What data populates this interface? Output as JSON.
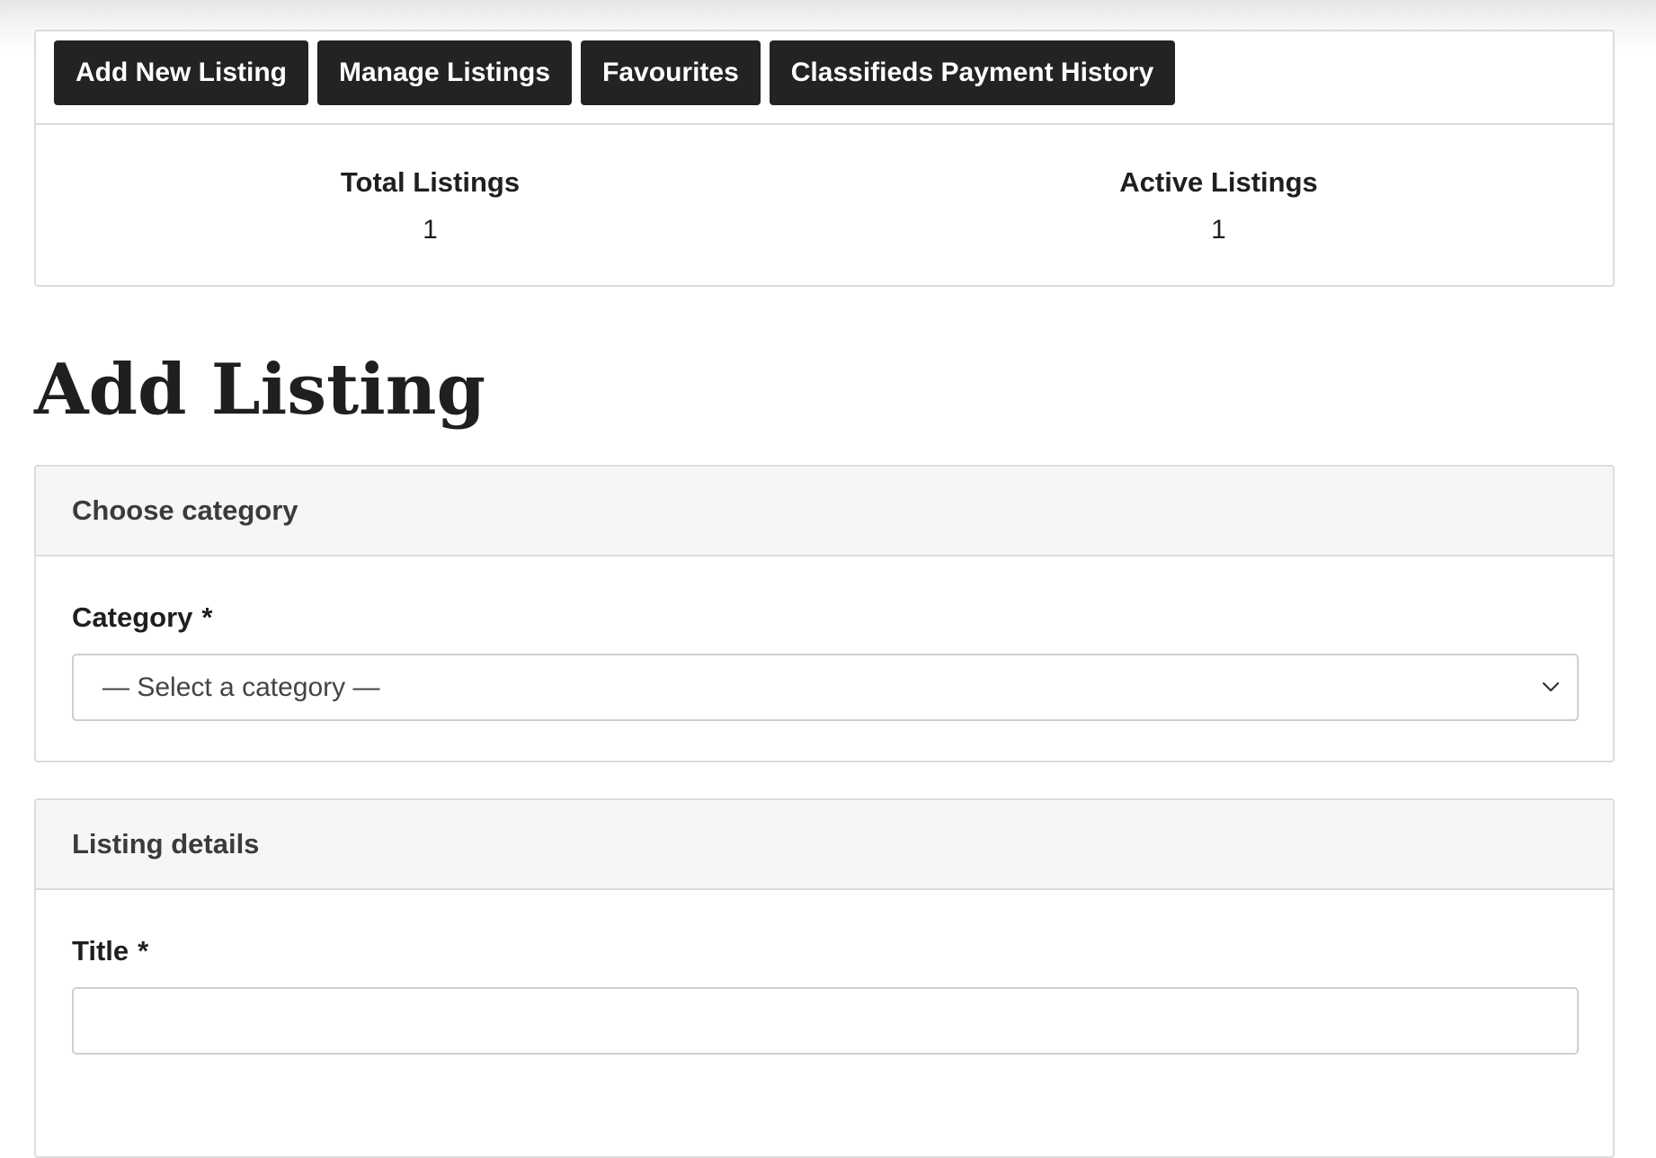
{
  "nav": {
    "add_new_listing": "Add New Listing",
    "manage_listings": "Manage Listings",
    "favourites": "Favourites",
    "payment_history": "Classifieds Payment History"
  },
  "stats": {
    "total_label": "Total Listings",
    "total_value": "1",
    "active_label": "Active Listings",
    "active_value": "1"
  },
  "page": {
    "title": "Add Listing"
  },
  "category_section": {
    "heading": "Choose category",
    "field_label": "Category",
    "required_mark": "*",
    "selected_value": "— Select a category —"
  },
  "details_section": {
    "heading": "Listing details",
    "title_label": "Title",
    "required_mark": "*",
    "title_value": ""
  },
  "icons": {
    "select_arrow": "chevron-down-icon"
  },
  "colors": {
    "button_bg": "#232323",
    "button_text": "#ffffff",
    "border": "#dcdcdc",
    "section_head_bg": "#f6f6f6"
  }
}
